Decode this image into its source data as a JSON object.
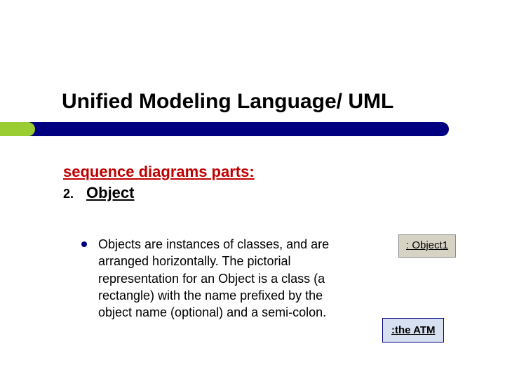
{
  "title": "Unified Modeling Language/ UML",
  "subtitle1": "sequence diagrams parts:",
  "list_number": "2.",
  "list_label": "Object",
  "body": "Objects are instances of classes, and are arranged horizontally. The pictorial representation for an Object is a class (a rectangle) with the name prefixed by the object name (optional) and a semi-colon.",
  "example1_prefix": ":",
  "example1_label": " Object1",
  "example2": ":the ATM"
}
